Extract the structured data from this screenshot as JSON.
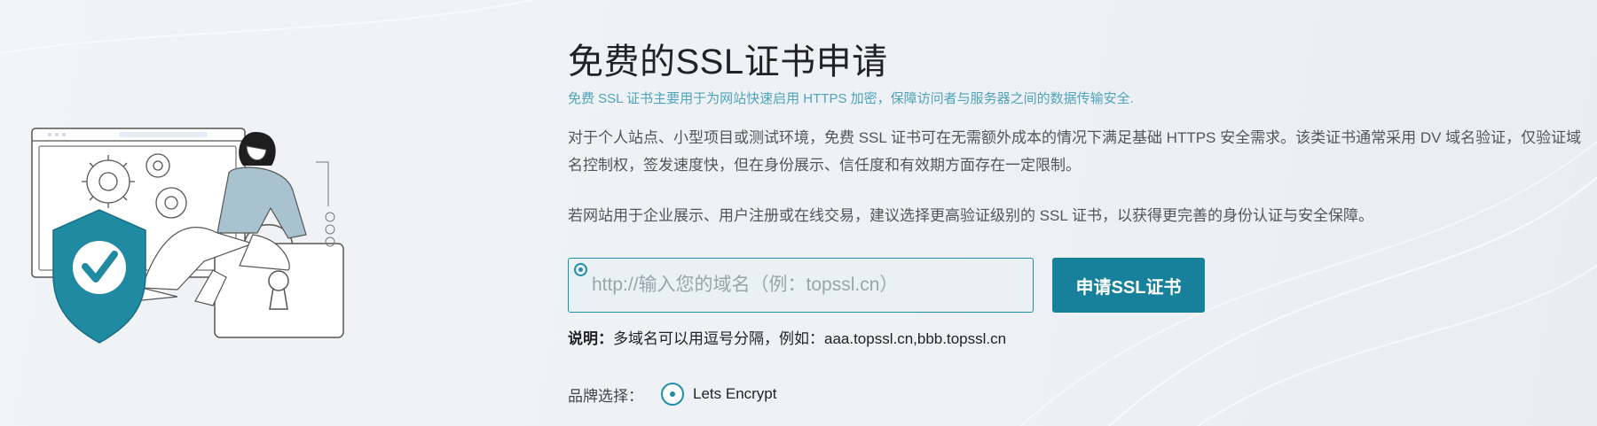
{
  "hero": {
    "title": "免费的SSL证书申请",
    "subtitle": "免费 SSL 证书主要用于为网站快速启用 HTTPS 加密，保障访问者与服务器之间的数据传输安全.",
    "paragraph1": "对于个人站点、小型项目或测试环境，免费 SSL 证书可在无需额外成本的情况下满足基础 HTTPS 安全需求。该类证书通常采用 DV 域名验证，仅验证域名控制权，签发速度快，但在身份展示、信任度和有效期方面存在一定限制。",
    "paragraph2": "若网站用于企业展示、用户注册或在线交易，建议选择更高验证级别的 SSL 证书，以获得更完善的身份认证与安全保障。"
  },
  "form": {
    "domain_placeholder": "http://输入您的域名（例：topssl.cn）",
    "domain_value": "",
    "apply_label": "申请SSL证书",
    "note_label": "说明：",
    "note_text": "多域名可以用逗号分隔，例如：aaa.topssl.cn,bbb.topssl.cn"
  },
  "brand": {
    "label": "品牌选择：",
    "selected": "Lets Encrypt"
  },
  "colors": {
    "accent": "#17819b",
    "subtitle": "#4fa3bb",
    "shield": "#1f8aa2"
  },
  "icons": [
    "security-shield-icon",
    "gear-icon",
    "lock-icon",
    "radio-selected-icon"
  ]
}
